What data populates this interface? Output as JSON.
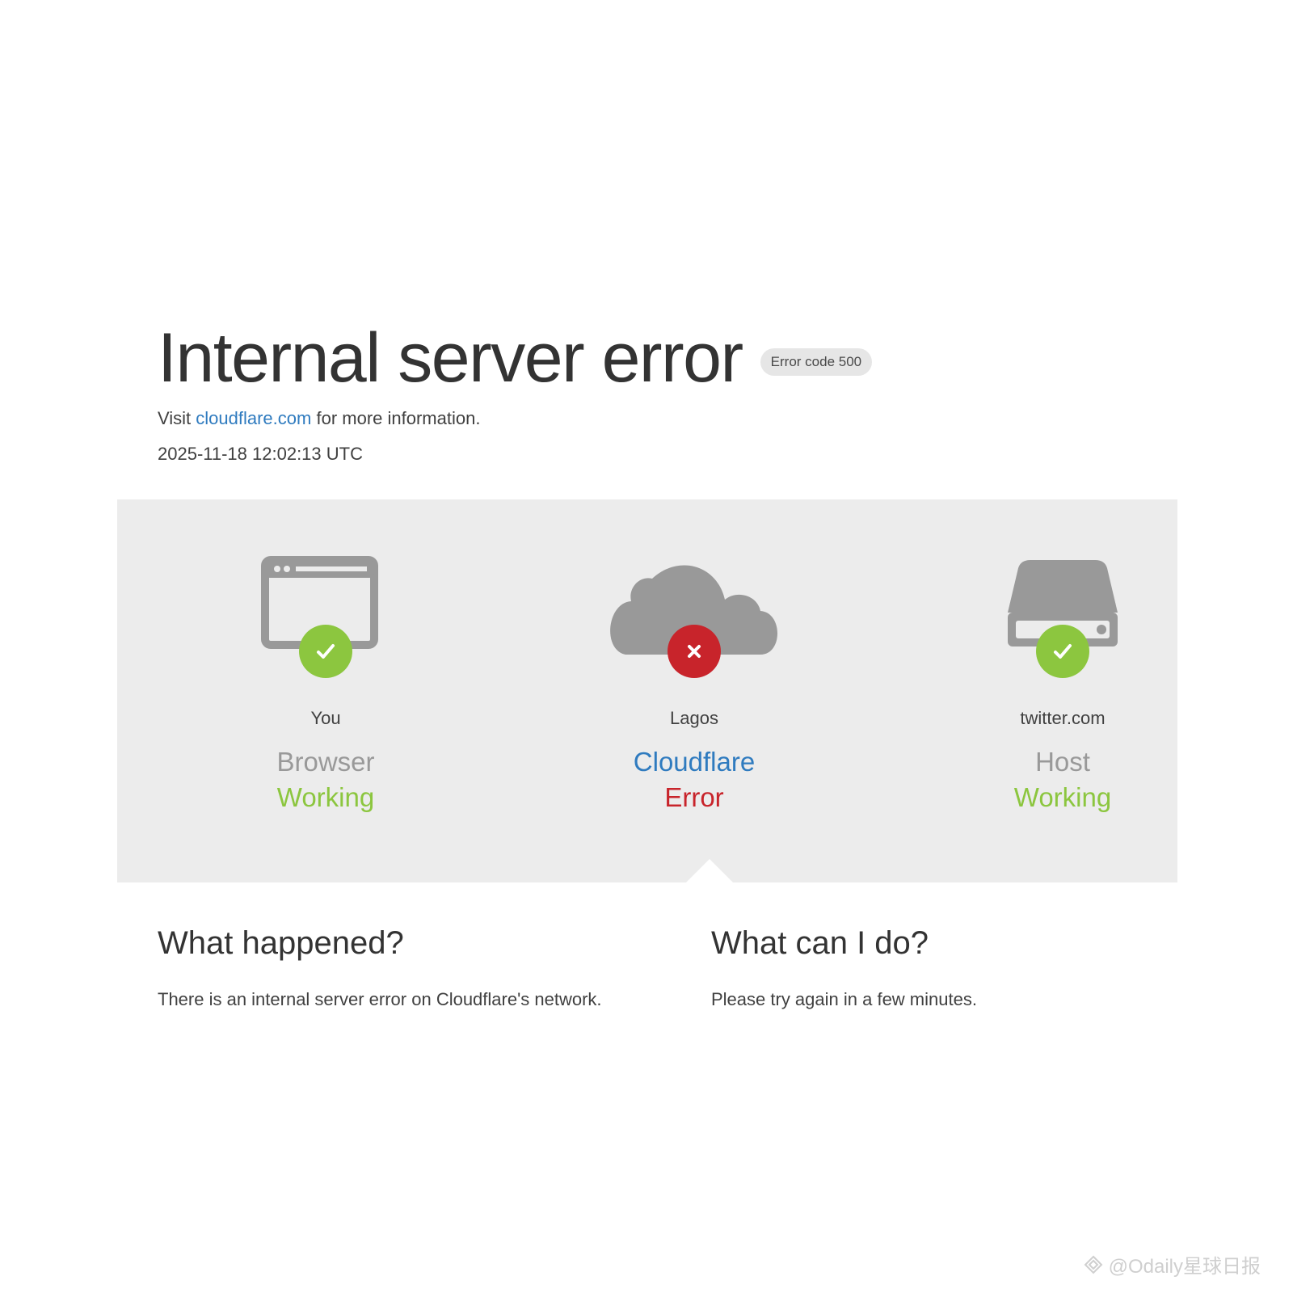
{
  "header": {
    "title": "Internal server error",
    "badge": "Error code 500",
    "visit_prefix": "Visit ",
    "visit_link": "cloudflare.com",
    "visit_suffix": " for more information.",
    "timestamp": "2025-11-18 12:02:13 UTC"
  },
  "status": [
    {
      "location": "You",
      "kind": "Browser",
      "state": "Working",
      "icon": "browser-window-icon",
      "result": "ok"
    },
    {
      "location": "Lagos",
      "kind": "Cloudflare",
      "state": "Error",
      "icon": "cloud-icon",
      "result": "error"
    },
    {
      "location": "twitter.com",
      "kind": "Host",
      "state": "Working",
      "icon": "server-icon",
      "result": "ok"
    }
  ],
  "explain": {
    "what_happened_title": "What happened?",
    "what_happened_text": "There is an internal server error on Cloudflare's network.",
    "what_can_i_do_title": "What can I do?",
    "what_can_i_do_text": "Please try again in a few minutes."
  },
  "watermark": "@Odaily星球日报",
  "colors": {
    "ok": "#8cc63f",
    "error": "#c8242b",
    "link": "#2f7bbf",
    "panel": "#ececec",
    "icon_gray": "#999999"
  }
}
